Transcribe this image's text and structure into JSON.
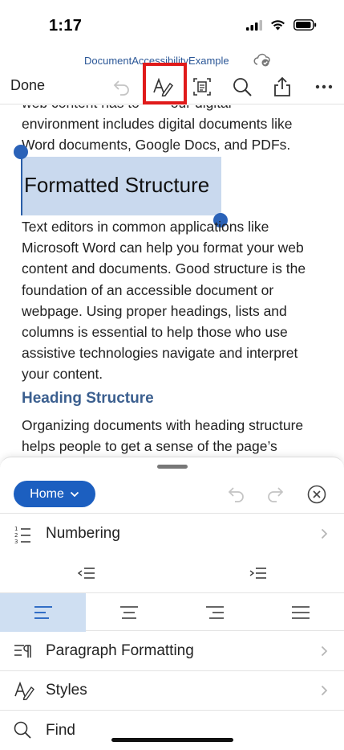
{
  "status_bar": {
    "time": "1:17"
  },
  "document": {
    "name": "DocumentAccessibilityExample"
  },
  "toolbar": {
    "done_label": "Done"
  },
  "body": {
    "para_intro": "web content has to ... our digital environment includes digital documents like Word documents, Google Docs, and PDFs.",
    "intro_line1": "web content has to        our digital",
    "intro_line2": "environment includes digital documents like",
    "intro_line3": "Word documents, Google Docs, and PDFs.",
    "heading1": "Formatted Structure",
    "para2_lines": [
      "Text editors in common applications like",
      "Microsoft Word can help you format your web",
      "content and documents. Good structure is the",
      "foundation of an accessible document or",
      "webpage. Using proper headings, lists and",
      "columns is essential to help those who use",
      "assistive technologies navigate and interpret",
      "your content."
    ],
    "heading2": "Heading Structure",
    "para3_lines": [
      "Organizing documents with heading structure",
      "helps people to get a sense of the page’s"
    ]
  },
  "sheet": {
    "tab_label": "Home",
    "rows": {
      "numbering": "Numbering",
      "paragraph_formatting": "Paragraph Formatting",
      "styles": "Styles",
      "find": "Find"
    }
  },
  "colors": {
    "accent": "#1c5fc0",
    "selection": "#c9d9ee",
    "heading2": "#3b5f8f",
    "highlight_box": "#e01a1a"
  }
}
